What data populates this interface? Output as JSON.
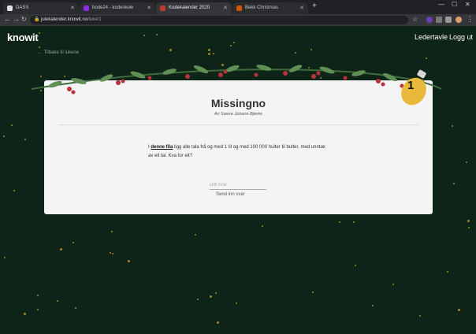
{
  "tabs": [
    {
      "label": "DASS",
      "color": "#e0e0e0"
    },
    {
      "label": "bode24 - kodeskole",
      "color": "#8a2be2"
    },
    {
      "label": "Kodekalender 2020",
      "color": "#c0392b"
    },
    {
      "label": "Bekk Christmas",
      "color": "#d35400"
    }
  ],
  "address": {
    "host": "julekalender.knowit.no",
    "path": "/luke/1"
  },
  "site": {
    "logo": "knowit",
    "nav": {
      "leaderboard": "Ledertavle",
      "logout": "Logg ut"
    },
    "back_link": "← Tilbake til lukene",
    "accent_color": "#e8b93a"
  },
  "puzzle": {
    "day": "1",
    "title": "Missingno",
    "author": "Av Sverre Johann Bjørke",
    "text_pre": "I",
    "link_text": "denne fila",
    "text_post": "ligg alle tala frå og med 1 til og med 100 000 hulter til bulter, med unntak av eit tal. Kva for eit?",
    "answer_placeholder": "Ditt svar",
    "submit_label": "Send inn svar"
  }
}
